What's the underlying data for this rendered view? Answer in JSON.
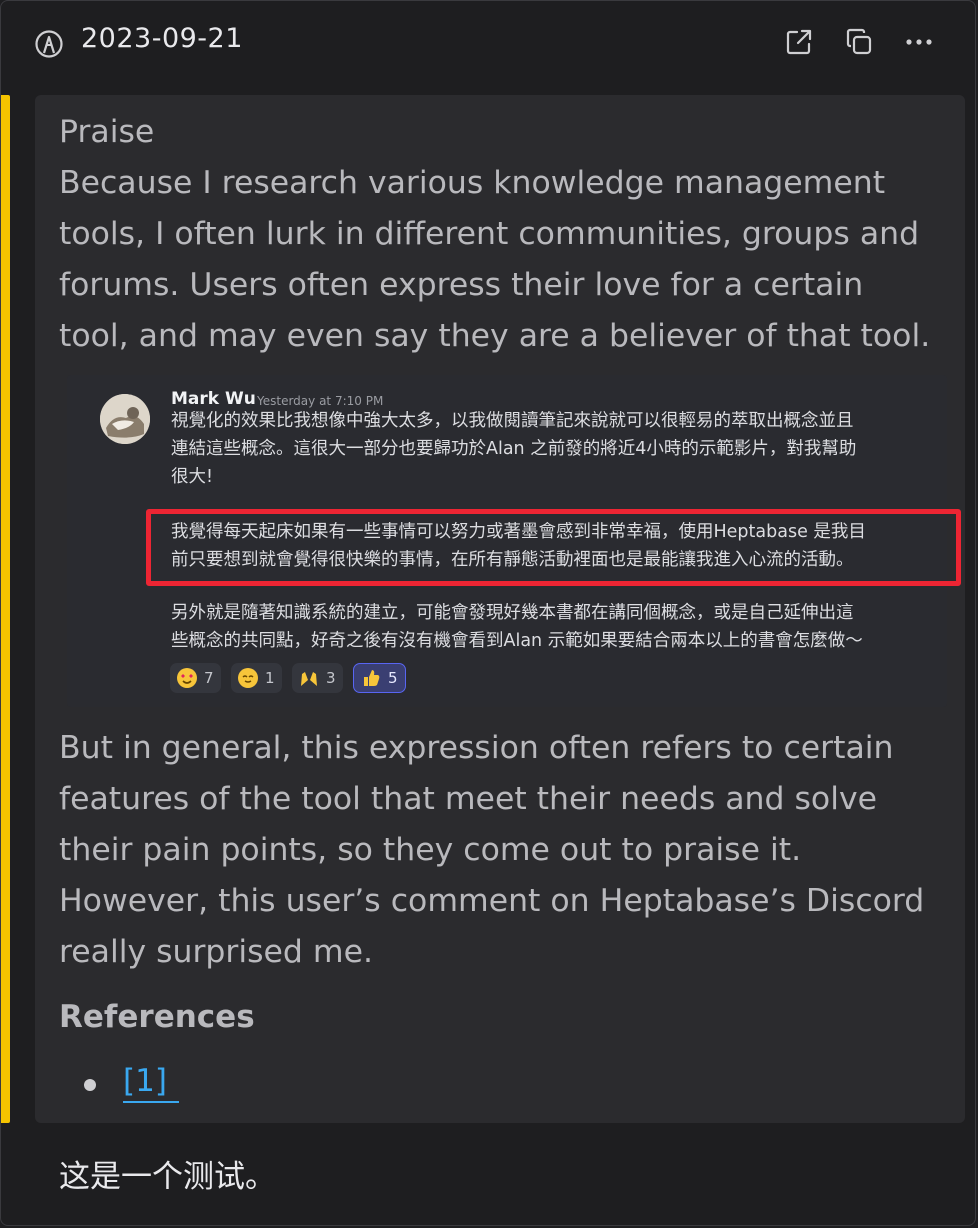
{
  "header": {
    "date": "2023-09-21",
    "icons": [
      "pen-icon",
      "open-external-icon",
      "duplicate-icon",
      "more-icon"
    ]
  },
  "quote": {
    "paragraph1": [
      "Praise",
      "Because I research various knowledge management",
      "tools, I often lurk in different communities, groups and",
      "forums. Users often express their love for a certain",
      "tool, and may even say they are a believer of that tool."
    ],
    "discord": {
      "author": "Mark Wu",
      "timestamp": "Yesterday at 7:10 PM",
      "message1": [
        "視覺化的效果比我想像中強大太多，以我做閱讀筆記來說就可以很輕易的萃取出概念並且",
        "連結這些概念。這很大一部分也要歸功於Alan 之前發的將近4小時的示範影片，對我幫助",
        "很大!"
      ],
      "message2": [
        "我覺得每天起床如果有一些事情可以努力或著墨會感到非常幸福，使用Heptabase 是我目",
        "前只要想到就會覺得很快樂的事情，在所有靜態活動裡面也是最能讓我進入心流的活動。"
      ],
      "message3": [
        "另外就是隨著知識系統的建立，可能會發現好幾本書都在講同個概念，或是自己延伸出這",
        "些概念的共同點，好奇之後有沒有機會看到Alan 示範如果要結合兩本以上的書會怎麼做～"
      ],
      "reactions": [
        {
          "icon": "heart-eyes-emoji-icon",
          "count": "7"
        },
        {
          "icon": "relieved-emoji-icon",
          "count": "1"
        },
        {
          "icon": "raised-hands-emoji-icon",
          "count": "3"
        },
        {
          "icon": "thumbs-up-emoji-icon",
          "count": "5"
        }
      ],
      "highlight_color": "#ed2533"
    },
    "paragraph2": [
      "But in general, this expression often refers to certain",
      "features of the tool that meet their needs and solve",
      "their pain points, so they come out to praise it.",
      "However, this user’s comment on Heptabase’s Discord",
      "really surprised me."
    ],
    "references_title": "References",
    "reference_link": "[1]"
  },
  "footer_text": "这是一个测试。",
  "colors": {
    "background": "#1e1e20",
    "quote_background": "#2b2b2e",
    "accent": "#f5c400",
    "link": "#3aa8f0"
  }
}
